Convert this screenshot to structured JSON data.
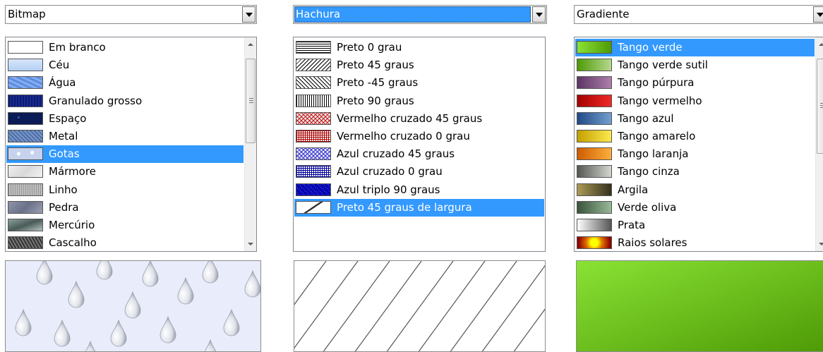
{
  "panels": [
    {
      "combo": "Bitmap",
      "combo_focused": false,
      "selected_index": 6,
      "items": [
        {
          "label": "Em branco",
          "icon": "blank-swatch"
        },
        {
          "label": "Céu",
          "icon": "sky-swatch"
        },
        {
          "label": "Água",
          "icon": "water-swatch"
        },
        {
          "label": "Granulado grosso",
          "icon": "coarse-grain-swatch"
        },
        {
          "label": "Espaço",
          "icon": "space-swatch"
        },
        {
          "label": "Metal",
          "icon": "metal-swatch"
        },
        {
          "label": "Gotas",
          "icon": "drops-swatch"
        },
        {
          "label": "Mármore",
          "icon": "marble-swatch"
        },
        {
          "label": "Linho",
          "icon": "linen-swatch"
        },
        {
          "label": "Pedra",
          "icon": "stone-swatch"
        },
        {
          "label": "Mercúrio",
          "icon": "mercury-swatch"
        },
        {
          "label": "Cascalho",
          "icon": "gravel-swatch"
        }
      ],
      "preview": "drops-bitmap-preview"
    },
    {
      "combo": "Hachura",
      "combo_focused": true,
      "selected_index": 9,
      "items": [
        {
          "label": "Preto 0 grau",
          "icon": "black-0-hatch"
        },
        {
          "label": "Preto 45 graus",
          "icon": "black-45-hatch"
        },
        {
          "label": "Preto -45 graus",
          "icon": "black-minus45-hatch"
        },
        {
          "label": "Preto 90 graus",
          "icon": "black-90-hatch"
        },
        {
          "label": "Vermelho cruzado 45 graus",
          "icon": "red-cross-45-hatch"
        },
        {
          "label": "Vermelho cruzado 0 grau",
          "icon": "red-cross-0-hatch"
        },
        {
          "label": "Azul cruzado 45 graus",
          "icon": "blue-cross-45-hatch"
        },
        {
          "label": "Azul cruzado 0 grau",
          "icon": "blue-cross-0-hatch"
        },
        {
          "label": "Azul triplo 90 graus",
          "icon": "blue-triple-90-hatch"
        },
        {
          "label": "Preto 45 graus de largura",
          "icon": "black-45-wide-hatch"
        }
      ],
      "preview": "wide-hatch-preview"
    },
    {
      "combo": "Gradiente",
      "combo_focused": false,
      "selected_index": 0,
      "items": [
        {
          "label": "Tango verde",
          "icon": "gradient-swatch",
          "colors": [
            "#8ae234",
            "#4e9a06"
          ]
        },
        {
          "label": "Tango verde sutil",
          "icon": "gradient-swatch",
          "colors": [
            "#4e9a06",
            "#b7d88e"
          ]
        },
        {
          "label": "Tango púrpura",
          "icon": "gradient-swatch",
          "colors": [
            "#5c3566",
            "#ad7fa8"
          ]
        },
        {
          "label": "Tango vermelho",
          "icon": "gradient-swatch",
          "colors": [
            "#a40000",
            "#ef2929"
          ]
        },
        {
          "label": "Tango azul",
          "icon": "gradient-swatch",
          "colors": [
            "#204a87",
            "#729fcf"
          ]
        },
        {
          "label": "Tango amarelo",
          "icon": "gradient-swatch",
          "colors": [
            "#c4a000",
            "#fce94f"
          ]
        },
        {
          "label": "Tango laranja",
          "icon": "gradient-swatch",
          "colors": [
            "#ce5c00",
            "#fcaf3e"
          ]
        },
        {
          "label": "Tango cinza",
          "icon": "gradient-swatch",
          "colors": [
            "#555753",
            "#d3d7cf"
          ]
        },
        {
          "label": "Argila",
          "icon": "gradient-swatch",
          "colors": [
            "#ad9b55",
            "#33301f"
          ]
        },
        {
          "label": "Verde oliva",
          "icon": "gradient-swatch",
          "colors": [
            "#3a533a",
            "#97b997"
          ]
        },
        {
          "label": "Prata",
          "icon": "gradient-swatch",
          "colors": [
            "#ffffff",
            "#555555"
          ]
        },
        {
          "label": "Raios solares",
          "icon": "radial-gradient-swatch",
          "colors": [
            "#ffff00",
            "#8b0000"
          ]
        }
      ],
      "preview_colors": [
        "#8ae234",
        "#4e9a06"
      ]
    }
  ]
}
